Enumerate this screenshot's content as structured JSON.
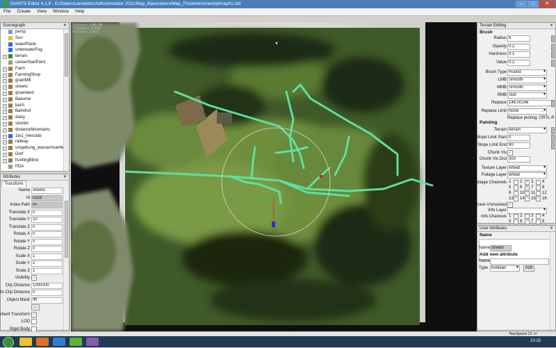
{
  "window": {
    "title": "GIANTS Editor 4.1.9 - D:/Daten/Landwirtschaftssimulator 2011/Map_Bauerdnerv/Map_Finsterbrunnental/map01.i3d"
  },
  "menu": [
    "File",
    "Create",
    "View",
    "Window",
    "Help"
  ],
  "scenegraph": {
    "title": "Scenegraph",
    "items": [
      {
        "label": "persp",
        "color": "#6aa0d8",
        "expand": false
      },
      {
        "label": "Sun",
        "color": "#e8c020",
        "expand": false
      },
      {
        "label": "waterPlane",
        "color": "#2f6fd0",
        "expand": false
      },
      {
        "label": "unterwaterFog",
        "color": "#2f6fd0",
        "expand": false
      },
      {
        "label": "terrain",
        "color": "#3a8a3a",
        "expand": true
      },
      {
        "label": "careerStartPoint",
        "color": "#999999",
        "expand": false
      },
      {
        "label": "Farm",
        "color": "#9a7a50",
        "expand": true
      },
      {
        "label": "FarmingShop",
        "color": "#9a7a50",
        "expand": true
      },
      {
        "label": "grainMill",
        "color": "#9a7a50",
        "expand": true
      },
      {
        "label": "streets",
        "color": "#9a7a50",
        "expand": true
      },
      {
        "label": "gruenland",
        "color": "#9a7a50",
        "expand": true
      },
      {
        "label": "Baeume",
        "color": "#9a7a50",
        "expand": true
      },
      {
        "label": "bach",
        "color": "#9a7a50",
        "expand": true
      },
      {
        "label": "Bahnhof",
        "color": "#9a7a50",
        "expand": true
      },
      {
        "label": "daisy",
        "color": "#9a7a50",
        "expand": true
      },
      {
        "label": "sounds",
        "color": "#9a7a50",
        "expand": true
      },
      {
        "label": "distanceMountains",
        "color": "#9a7a50",
        "expand": true
      },
      {
        "label": "1to1_messtab",
        "color": "#3a6ad0",
        "expand": true
      },
      {
        "label": "railway",
        "color": "#9a7a50",
        "expand": true
      },
      {
        "label": "umgebung_wassermuehle",
        "color": "#9a7a50",
        "expand": true
      },
      {
        "label": "Dorf",
        "color": "#9a7a50",
        "expand": true
      },
      {
        "label": "huntingBlind",
        "color": "#9a7a50",
        "expand": true
      },
      {
        "label": "PDA",
        "color": "#999999",
        "expand": false
      }
    ]
  },
  "attributes": {
    "title": "Attributes",
    "tab": "Transform",
    "rows": [
      {
        "key": "Name",
        "value": "streets",
        "kind": "text"
      },
      {
        "key": "Id",
        "value": "5118",
        "kind": "gray"
      },
      {
        "key": "Index Path",
        "value": "9>",
        "kind": "gray"
      },
      {
        "key": "Translate X",
        "value": "0",
        "kind": "text"
      },
      {
        "key": "Translate Y",
        "value": "10",
        "kind": "text"
      },
      {
        "key": "Translate Z",
        "value": "0",
        "kind": "text"
      },
      {
        "key": "Rotate X",
        "value": "0",
        "kind": "text"
      },
      {
        "key": "Rotate Y",
        "value": "0",
        "kind": "text"
      },
      {
        "key": "Rotate Z",
        "value": "0",
        "kind": "text"
      },
      {
        "key": "Scale X",
        "value": "1",
        "kind": "text"
      },
      {
        "key": "Scale Y",
        "value": "1",
        "kind": "text"
      },
      {
        "key": "Scale Z",
        "value": "1",
        "kind": "text"
      },
      {
        "key": "Visibility",
        "value": "✓",
        "kind": "check"
      },
      {
        "key": "Clip Distance",
        "value": "1000000",
        "kind": "text"
      },
      {
        "key": "Min Clip Distance",
        "value": "0",
        "kind": "text"
      },
      {
        "key": "Object Mask",
        "value": "ffff",
        "kind": "text"
      },
      {
        "key": "",
        "value": "...",
        "kind": "button"
      },
      {
        "key": "Inherit Transform",
        "value": "✓",
        "kind": "check"
      },
      {
        "key": "LOD",
        "value": "",
        "kind": "check"
      },
      {
        "key": "Rigid Body",
        "value": "",
        "kind": "check"
      }
    ]
  },
  "viewport": {
    "info": [
      "Distance 1880.00",
      "Triangles 47070",
      "Vertices 23511"
    ],
    "corner_label": "PDA"
  },
  "terrain_editing": {
    "title": "Terrain Editing",
    "brush_header": "Brush",
    "painting_header": "Painting",
    "brush_rows": [
      {
        "key": "Radius",
        "value": "6"
      },
      {
        "key": "Opacity",
        "value": "0.2"
      },
      {
        "key": "Hardness",
        "value": "0.1"
      },
      {
        "key": "Value",
        "value": "0.2"
      }
    ],
    "brush_combos": [
      {
        "key": "Brush Type",
        "value": "Round"
      },
      {
        "key": "LMB",
        "value": "Smooth"
      },
      {
        "key": "MMB",
        "value": "Smooth"
      },
      {
        "key": "RMB",
        "value": "Sub"
      }
    ],
    "replace": {
      "key": "Replace",
      "value": "148.00146"
    },
    "replace_limit": {
      "key": "Replace Limit",
      "value": "None"
    },
    "replace_note": "Replace picking: CRTL-R",
    "terrain": {
      "key": "Terrain",
      "value": "terrain"
    },
    "slope_start": {
      "key": "Slope Limit Start",
      "value": "0"
    },
    "slope_end": {
      "key": "Slope Limit End",
      "value": "90"
    },
    "chunk_vis": {
      "key": "Chunk Vis",
      "value": "✓"
    },
    "chunk_vis_dist": {
      "key": "Chunk Vis Dist",
      "value": "300"
    },
    "texture_layer": {
      "key": "Texture Layer",
      "value": "wheat"
    },
    "foliage_layer": {
      "key": "Foliage Layer",
      "value": "wheat"
    },
    "foliage_channels_label": "Foliage Channels",
    "foliage_channels": [
      "1",
      "2",
      "3",
      "4",
      "5",
      "6",
      "7",
      "8",
      "9",
      "10",
      "11",
      "12",
      "13",
      "14",
      "15",
      "16"
    ],
    "foliage_checked": [
      "2",
      "6"
    ],
    "erase_unmasked": {
      "key": "Erase Unmasked",
      "value": "✓"
    },
    "info_layer": {
      "key": "Info Layer",
      "value": ""
    },
    "info_channels_label": "Info Channels",
    "info_channels": [
      "1",
      "2",
      "3",
      "4",
      "5",
      "6",
      "7",
      "8",
      "9",
      "10",
      "11",
      "12"
    ]
  },
  "user_attributes": {
    "title": "User Attributes",
    "list_header": "Name",
    "name_label": "Name",
    "name_value": "streets",
    "add_header": "Add new attribute",
    "new_name_label": "Name",
    "type_label": "Type",
    "type_value": "boolean",
    "add_button": "Add"
  },
  "statusbar": {
    "navspeed": "NavSpeed 21 +/-"
  },
  "taskbar": {
    "clock": "23:25"
  }
}
